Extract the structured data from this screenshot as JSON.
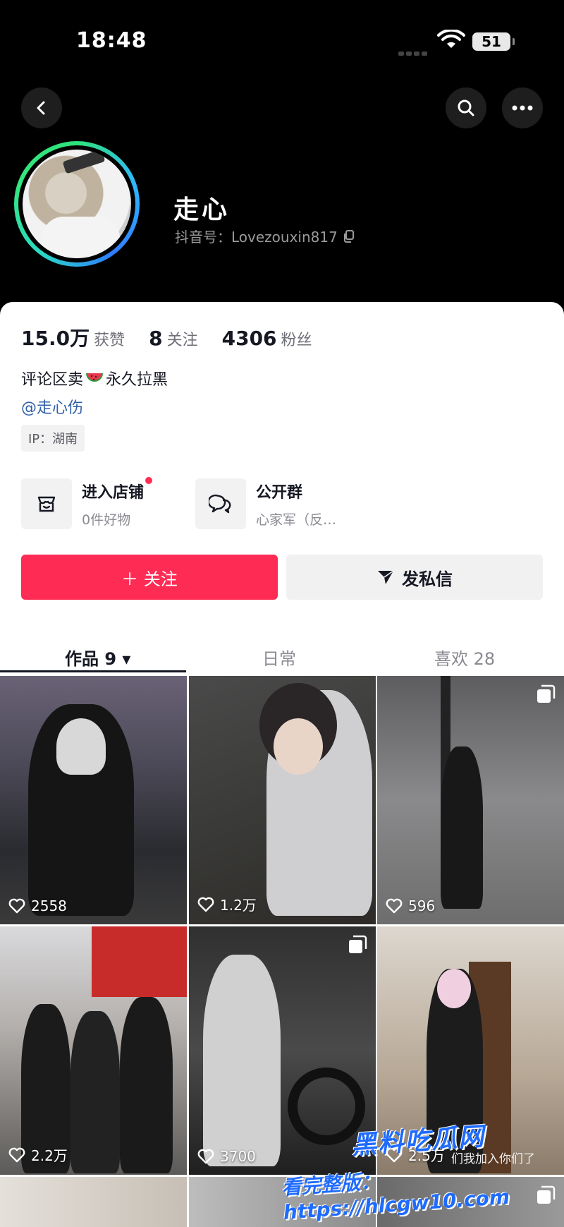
{
  "status_bar": {
    "time": "18:48",
    "battery": "51"
  },
  "profile": {
    "nickname": "走心",
    "douyin_id": "抖音号：Lovezouxin817",
    "stats": [
      {
        "value": "15.0万",
        "label": "获赞"
      },
      {
        "value": "8",
        "label": "关注"
      },
      {
        "value": "4306",
        "label": "粉丝"
      }
    ],
    "bio_before": "评论区卖",
    "bio_after": "永久拉黑",
    "mention": "@走心伤",
    "ip": "IP：湖南"
  },
  "features": {
    "shop": {
      "title": "进入店铺",
      "subtitle": "0件好物"
    },
    "group": {
      "title": "公开群",
      "subtitle": "心家军（反…"
    }
  },
  "actions": {
    "follow": "＋ 关注",
    "message": "发私信"
  },
  "tabs": [
    {
      "label": "作品 9 ▾"
    },
    {
      "label": "日常"
    },
    {
      "label": "喜欢 28"
    }
  ],
  "posts": [
    {
      "likes": "2558"
    },
    {
      "likes": "1.2万"
    },
    {
      "likes": "596"
    },
    {
      "likes": "2.2万"
    },
    {
      "likes": "3700"
    },
    {
      "likes": "2.5万"
    }
  ],
  "watermark": {
    "brand": "黑料吃瓜网",
    "url": "看完整版：https://hlcgw10.com",
    "overlay": "们我加入你们了"
  },
  "colors": {
    "accent": "#fe2c55",
    "link": "#2f5fa7"
  }
}
